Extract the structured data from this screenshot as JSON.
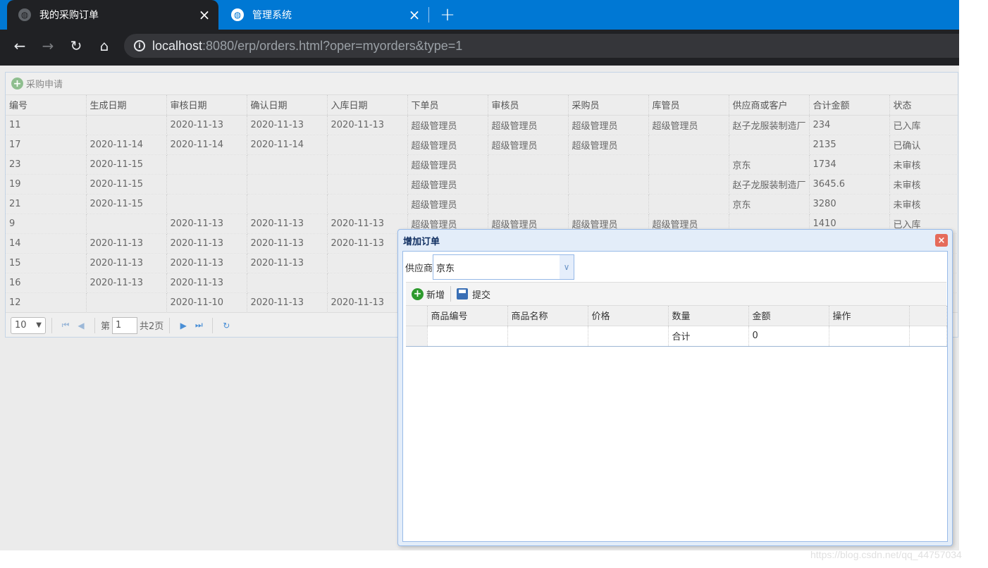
{
  "browser": {
    "tabs": [
      {
        "title": "我的采购订单",
        "active": true
      },
      {
        "title": "管理系统",
        "active": false
      }
    ],
    "url_host": "localhost",
    "url_rest": ":8080/erp/orders.html?oper=myorders&type=1"
  },
  "grid": {
    "toolbar_add_label": "采购申请",
    "columns": [
      "编号",
      "生成日期",
      "审核日期",
      "确认日期",
      "入库日期",
      "下单员",
      "审核员",
      "采购员",
      "库管员",
      "供应商或客户",
      "合计金额",
      "状态"
    ],
    "rows": [
      [
        "11",
        "",
        "2020-11-13",
        "2020-11-13",
        "2020-11-13",
        "超级管理员",
        "超级管理员",
        "超级管理员",
        "超级管理员",
        "赵子龙服装制造厂",
        "234",
        "已入库"
      ],
      [
        "17",
        "2020-11-14",
        "2020-11-14",
        "2020-11-14",
        "",
        "超级管理员",
        "超级管理员",
        "超级管理员",
        "",
        "",
        "2135",
        "已确认"
      ],
      [
        "23",
        "2020-11-15",
        "",
        "",
        "",
        "超级管理员",
        "",
        "",
        "",
        "京东",
        "1734",
        "未审核"
      ],
      [
        "19",
        "2020-11-15",
        "",
        "",
        "",
        "超级管理员",
        "",
        "",
        "",
        "赵子龙服装制造厂",
        "3645.6",
        "未审核"
      ],
      [
        "21",
        "2020-11-15",
        "",
        "",
        "",
        "超级管理员",
        "",
        "",
        "",
        "京东",
        "3280",
        "未审核"
      ],
      [
        "9",
        "",
        "2020-11-13",
        "2020-11-13",
        "2020-11-13",
        "超级管理员",
        "超级管理员",
        "超级管理员",
        "超级管理员",
        "",
        "1410",
        "已入库"
      ],
      [
        "14",
        "2020-11-13",
        "2020-11-13",
        "2020-11-13",
        "2020-11-13",
        "",
        "",
        "",
        "",
        "",
        "",
        ""
      ],
      [
        "15",
        "2020-11-13",
        "2020-11-13",
        "2020-11-13",
        "",
        "",
        "",
        "",
        "",
        "",
        "",
        ""
      ],
      [
        "16",
        "2020-11-13",
        "2020-11-13",
        "",
        "",
        "",
        "",
        "",
        "",
        "",
        "",
        ""
      ],
      [
        "12",
        "",
        "2020-11-10",
        "2020-11-13",
        "2020-11-13",
        "",
        "",
        "",
        "",
        "",
        "",
        ""
      ]
    ]
  },
  "pager": {
    "page_size": "10",
    "page_prefix": "第",
    "page_number": "1",
    "page_total": "共2页"
  },
  "dialog": {
    "title": "增加订单",
    "supplier_label": "供应商",
    "supplier_value": "京东",
    "add_label": "新增",
    "submit_label": "提交",
    "columns": [
      "商品编号",
      "商品名称",
      "价格",
      "数量",
      "金额",
      "操作"
    ],
    "footer_row": [
      "",
      "",
      "",
      "合计",
      "0",
      ""
    ]
  },
  "watermark": "https://blog.csdn.net/qq_44757034"
}
